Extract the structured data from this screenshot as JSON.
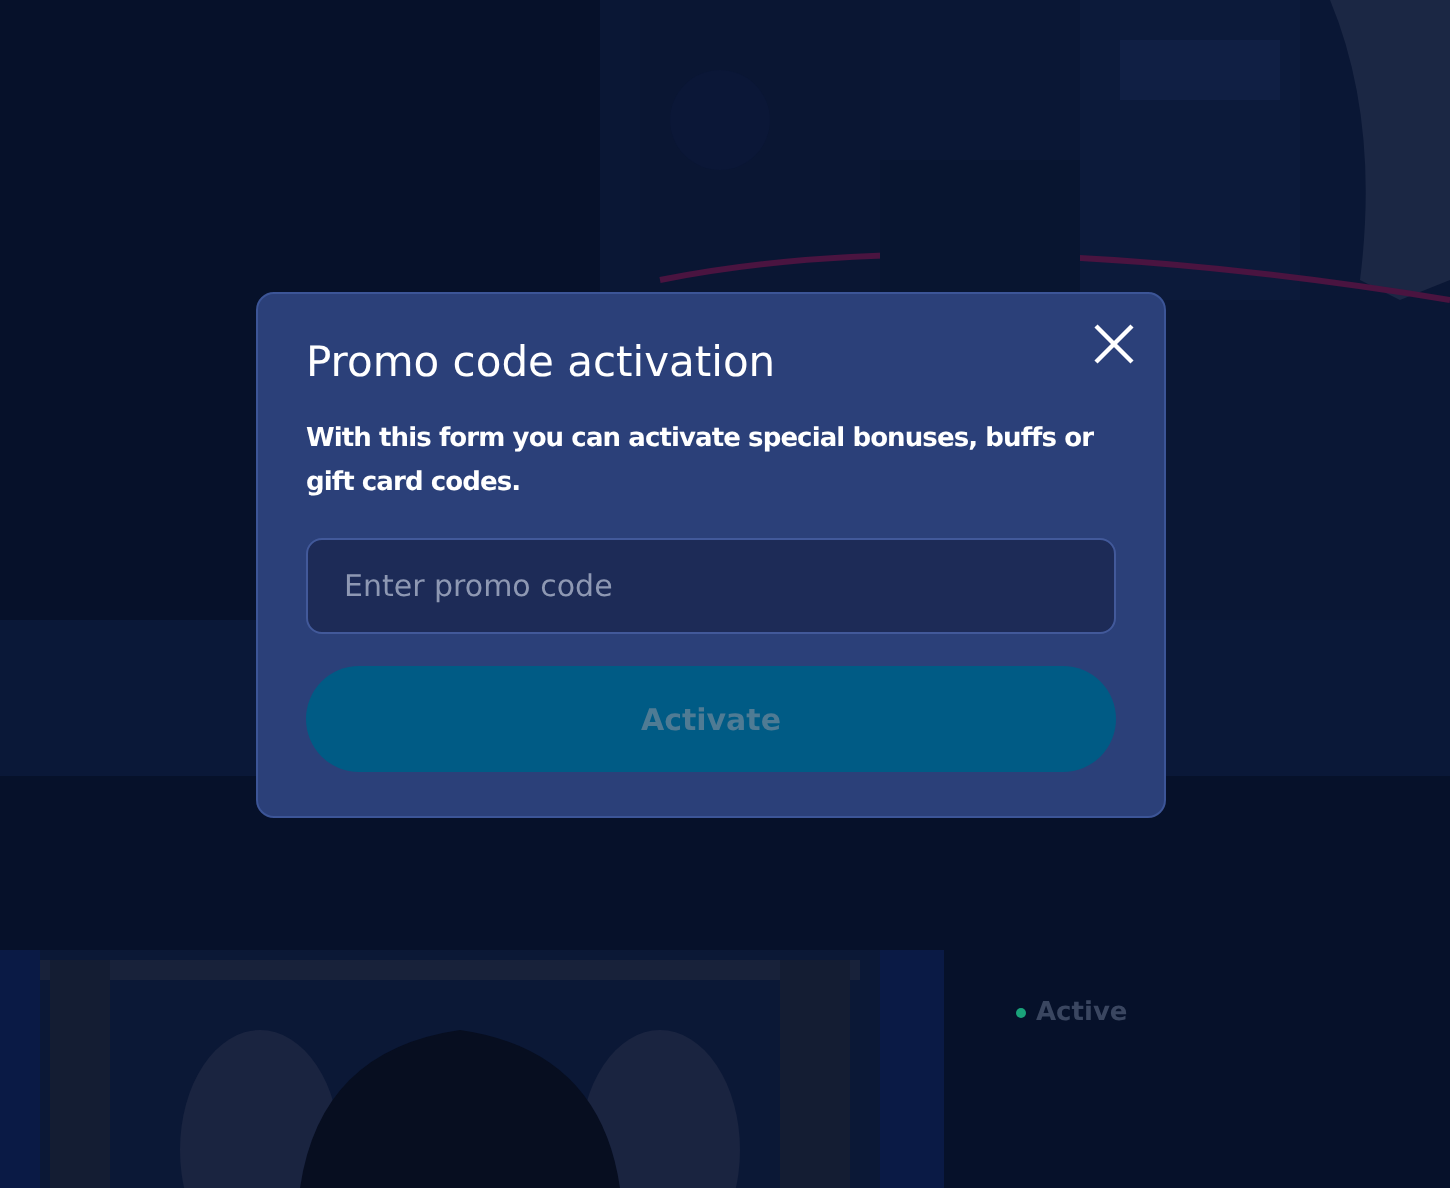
{
  "background": {
    "status": {
      "label": "Active",
      "color": "#1aa37a"
    }
  },
  "dialog": {
    "title": "Promo code activation",
    "description": "With this form you can activate special bonuses, buffs or gift card codes.",
    "field": {
      "placeholder": "Enter promo code"
    },
    "button": {
      "label": "Activate",
      "disabled": true
    }
  }
}
